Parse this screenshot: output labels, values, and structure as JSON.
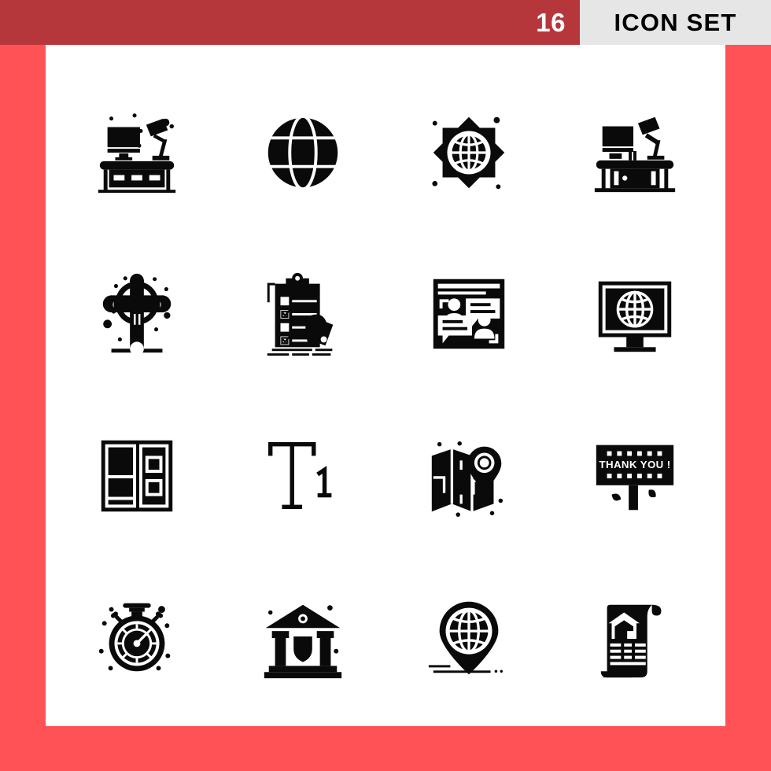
{
  "header": {
    "count": "16",
    "title": "ICON SET",
    "bar_color": "#b5373c",
    "panel_color": "#e6e6e6",
    "count_text_color": "#ffffff",
    "title_text_color": "#000000"
  },
  "page": {
    "background_color": "#ff5257",
    "card_color": "#ffffff",
    "icon_color": "#0a0a0a"
  },
  "icons": [
    {
      "index": "1",
      "name": "workspace-desk-lamp-monitor-icon",
      "label": "Workspace"
    },
    {
      "index": "2",
      "name": "globe-world-grid-icon",
      "label": "Globe"
    },
    {
      "index": "3",
      "name": "global-network-burst-icon",
      "label": "Global Network"
    },
    {
      "index": "4",
      "name": "office-desk-monitor-lamp-icon",
      "label": "Office Desk"
    },
    {
      "index": "5",
      "name": "celtic-cross-memorial-icon",
      "label": "Cross"
    },
    {
      "index": "6",
      "name": "clipboard-checklist-hand-icon",
      "label": "Checklist"
    },
    {
      "index": "7",
      "name": "chat-conversation-users-icon",
      "label": "Conversation"
    },
    {
      "index": "8",
      "name": "monitor-globe-internet-icon",
      "label": "Web Browsing"
    },
    {
      "index": "9",
      "name": "layout-wireframe-grid-icon",
      "label": "Layout"
    },
    {
      "index": "10",
      "name": "text-heading-t1-icon",
      "label": "Heading 1"
    },
    {
      "index": "11",
      "name": "folded-map-location-pin-icon",
      "label": "Map"
    },
    {
      "index": "12",
      "name": "thank-you-billboard-sign-icon",
      "label": "Billboard"
    },
    {
      "index": "13",
      "name": "stopwatch-timer-icon",
      "label": "Stopwatch"
    },
    {
      "index": "14",
      "name": "bank-building-shield-icon",
      "label": "Secure Bank"
    },
    {
      "index": "15",
      "name": "globe-location-pin-icon",
      "label": "Global Location"
    },
    {
      "index": "16",
      "name": "property-house-document-icon",
      "label": "Property Document"
    }
  ],
  "billboard": {
    "message": "THANK YOU !"
  },
  "typography_icon": {
    "letter": "T",
    "subscript": "1"
  }
}
